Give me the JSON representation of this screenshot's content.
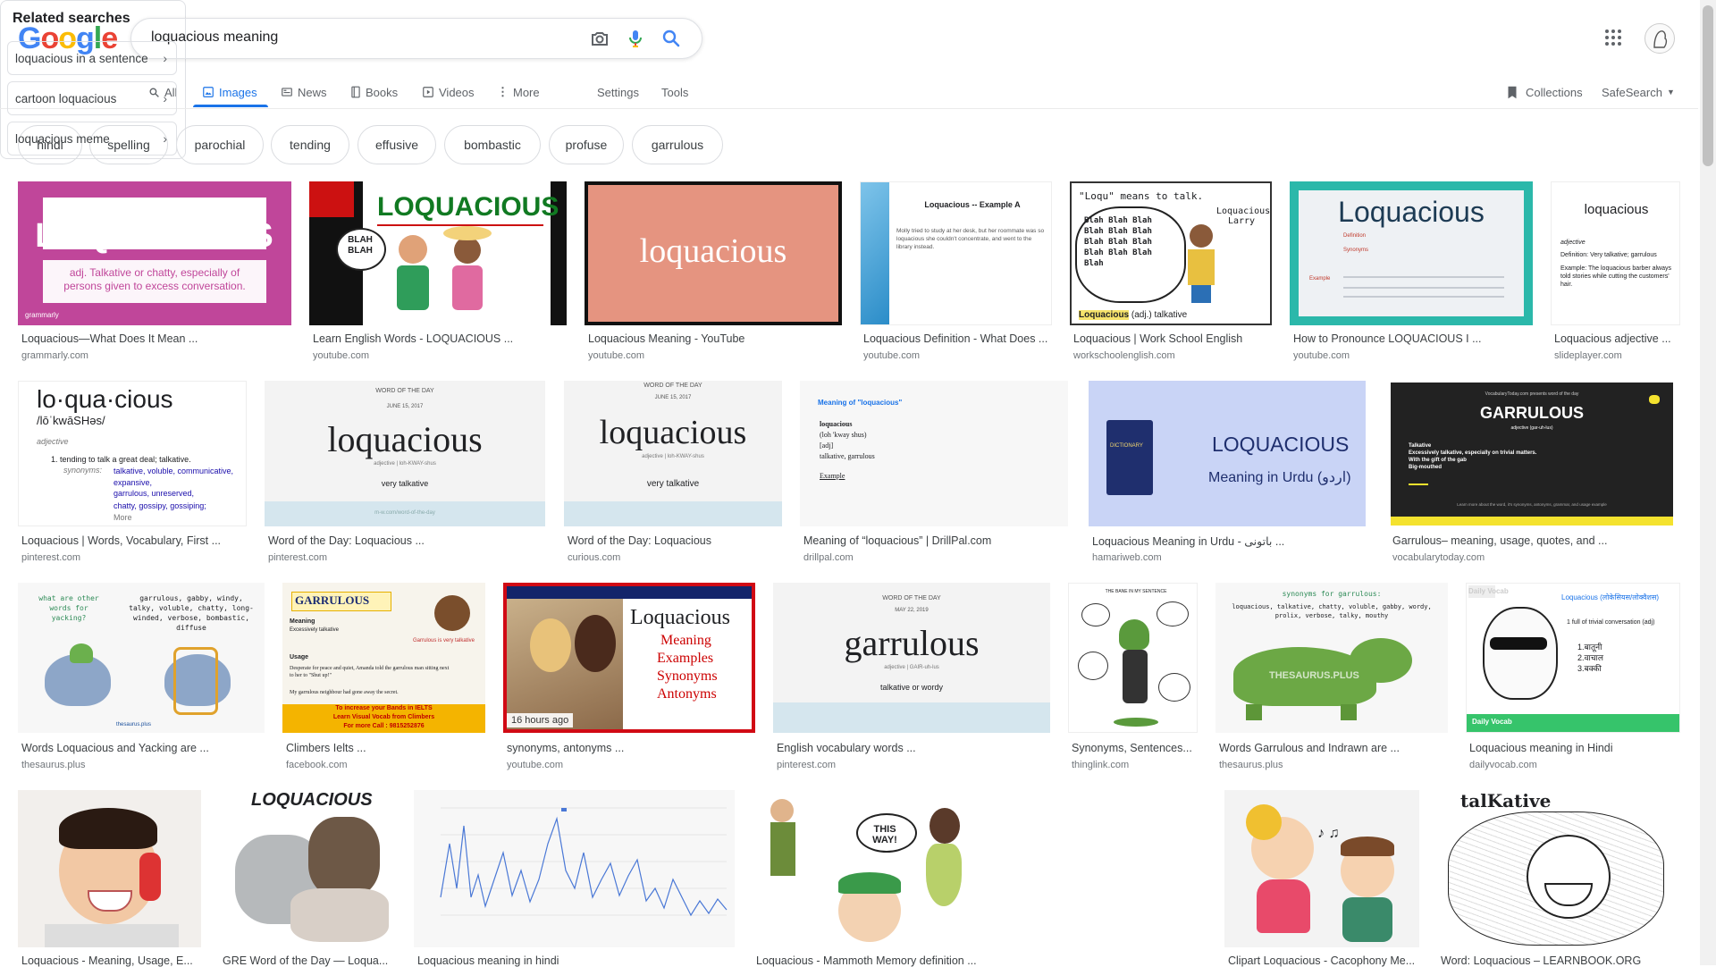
{
  "logo": "Google",
  "search": {
    "query": "loquacious meaning"
  },
  "nav": {
    "tabs": [
      "All",
      "Images",
      "News",
      "Books",
      "Videos",
      "More"
    ],
    "settings": "Settings",
    "tools": "Tools",
    "collections": "Collections",
    "safesearch": "SafeSearch"
  },
  "chips": [
    "hindi",
    "spelling",
    "parochial",
    "tending",
    "effusive",
    "bombastic",
    "profuse",
    "garrulous"
  ],
  "thumb_text": {
    "t1_word": "LOQUACIOUS",
    "t1_def": "adj. Talkative or chatty, especially of persons given to excess conversation.",
    "t1_brand": "grammarly",
    "t2_word": "LOQUACIOUS",
    "t2_blah": "BLAH BLAH",
    "t3_word": "loquacious",
    "t4_title": "Loquacious -- Example A",
    "t4_body": "Molly tried to study at her desk, but her roommate was so loquacious she couldn't concentrate, and went to the library instead.",
    "t5_quote": "\"Loqu\" means to talk.",
    "t5_name": "Loquacious Larry",
    "t5_def_word": "Loquacious",
    "t5_def": "(adj.) talkative",
    "t6_word": "Loquacious",
    "t6_label_def": "Definition",
    "t6_label_syn": "Synonyms",
    "t6_label_ex": "Example",
    "t7_word": "loquacious",
    "t7_pos": "adjective",
    "t7_def": "Definition: Very talkative; garrulous",
    "t7_ex": "Example: The loquacious barber always told stories while cutting the customers' hair.",
    "t8_word": "lo·qua·cious",
    "t8_pron": "/lōˈkwāSHəs/",
    "t8_pos": "adjective",
    "t8_def": "1. tending to talk a great deal; talkative.",
    "t8_syn_label": "synonyms:",
    "t8_syn1": "talkative, voluble, communicative, expansive,",
    "t8_syn2": "garrulous, unreserved,",
    "t8_syn3": "chatty, gossipy, gossiping;",
    "t8_more": "More",
    "wotd": "WORD OF THE DAY",
    "t9_date": "JUNE 15, 2017",
    "t9_word": "loquacious",
    "t9_pron": "adjective | loh-KWAY-shus",
    "t9_def": "very talkative",
    "t9_footer": "m-w.com/word-of-the-day",
    "t10_date": "JUNE 15, 2017",
    "t10_word": "loquacious",
    "t10_pron": "adjective | loh-KWAY-shus",
    "t10_def": "very talkative",
    "t11_title": "Meaning of \"loquacious\"",
    "t11_l1": "loquacious",
    "t11_l2": "(loh 'kway shus)",
    "t11_l3": "[adj]",
    "t11_l4": "talkative, garrulous",
    "t11_l5": "Example",
    "t12_word": "LOQUACIOUS",
    "t12_sub": "Meaning in Urdu (اردو)",
    "t12_book": "DICTIONARY",
    "t13_top": "VocabularyToday.com presents word of the day",
    "t13_word": "GARRULOUS",
    "t13_pos": "adjective (gar-uh-lus)",
    "t13_b1": "Talkative",
    "t13_b2": "Excessively talkative, especially on trivial matters.",
    "t13_b3": "With the gift of the gab",
    "t13_b4": "Big-mouthed",
    "t13_foot": "Learn more about the word, it's synonyms, antonyms, grammar, and usage example",
    "t14_left": "what are other words for yacking?",
    "t14_right": "garrulous, gabby, windy, talky, voluble, chatty, long-winded, verbose, bombastic, diffuse",
    "t14_brand": "thesaurus.plus",
    "t15_word": "GARRULOUS",
    "t15_m": "Meaning",
    "t15_m2": "Excessively talkative",
    "t15_u": "Usage",
    "t15_u1": "Desperate for peace and quiet, Amanda told the garrulous man sitting next to her to \"Shut up!\"",
    "t15_u2": "My garrulous neighbour had gone away the secret.",
    "t15_banner1": "To increase your Bands in IELTS",
    "t15_banner2": "Learn Visual Vocab from Climbers",
    "t15_banner3": "For more Call : 9815252876",
    "t15_bubble": "Garrulous is very talkative",
    "t16_word": "Loquacious",
    "t16_l1": "Meaning",
    "t16_l2": "Examples",
    "t16_l3": "Synonyms",
    "t16_l4": "Antonyms",
    "t16_badge": "16 hours ago",
    "t17_date": "MAY 22, 2019",
    "t17_word": "garrulous",
    "t17_pron": "adjective | GAIR-uh-lus",
    "t17_def": "talkative or wordy",
    "t18_title": "THE BANE IN MY SENTENCE",
    "t19_title": "synonyms for garrulous:",
    "t19_body": "loquacious, talkative, chatty, voluble, gabby, wordy, prolix, verbose, talky, mouthy",
    "t19_brand": "THESAURUS.PLUS",
    "t20_title": "Loquacious (लोकेसियस/लोक्वैशस)",
    "t20_brand": "Daily Vocab",
    "t20_def": "1 full of trivial conversation (adj)",
    "t20_h1": "1.बातूनी",
    "t20_h2": "2.वाचाल",
    "t20_h3": "3.बक्की",
    "t20_footer": "Daily Vocab",
    "t22_word": "LOQUACIOUS",
    "t25_bubble": "THIS WAY!",
    "t27_word": "talKative"
  },
  "results": [
    {
      "title": "Loquacious—What Does It Mean ...",
      "source": "grammarly.com"
    },
    {
      "title": "Learn English Words - LOQUACIOUS ...",
      "source": "youtube.com"
    },
    {
      "title": "Loquacious Meaning - YouTube",
      "source": "youtube.com"
    },
    {
      "title": "Loquacious Definition - What Does ...",
      "source": "youtube.com"
    },
    {
      "title": "Loquacious | Work School English",
      "source": "workschoolenglish.com"
    },
    {
      "title": "How to Pronounce LOQUACIOUS I ...",
      "source": "youtube.com"
    },
    {
      "title": "Loquacious adjective ...",
      "source": "slideplayer.com"
    },
    {
      "title": "Loquacious | Words, Vocabulary, First ...",
      "source": "pinterest.com"
    },
    {
      "title": "Word of the Day: Loquacious ...",
      "source": "pinterest.com"
    },
    {
      "title": "Word of the Day: Loquacious",
      "source": "curious.com"
    },
    {
      "title": "Meaning of “loquacious” | DrillPal.com",
      "source": "drillpal.com"
    },
    {
      "title": "Loquacious Meaning in Urdu - باتونی ...",
      "source": "hamariweb.com"
    },
    {
      "title": "Garrulous– meaning, usage, quotes, and ...",
      "source": "vocabularytoday.com"
    },
    {
      "title": "Words Loquacious and Yacking are ...",
      "source": "thesaurus.plus"
    },
    {
      "title": "Climbers Ielts ...",
      "source": "facebook.com"
    },
    {
      "title": "synonyms, antonyms ...",
      "source": "youtube.com"
    },
    {
      "title": "English vocabulary words ...",
      "source": "pinterest.com"
    },
    {
      "title": "Synonyms, Sentences...",
      "source": "thinglink.com"
    },
    {
      "title": "Words Garrulous and Indrawn are ...",
      "source": "thesaurus.plus"
    },
    {
      "title": "Loquacious meaning in Hindi",
      "source": "dailyvocab.com"
    },
    {
      "title": "Loquacious - Meaning, Usage, E...",
      "source": ""
    },
    {
      "title": "GRE Word of the Day — Loqua...",
      "source": ""
    },
    {
      "title": "Loquacious meaning in hindi",
      "source": ""
    },
    {
      "title": "Loquacious - Mammoth Memory definition ...",
      "source": ""
    },
    {
      "title": "Clipart Loquacious - Cacophony Me...",
      "source": ""
    },
    {
      "title": "Word: Loquacious – LEARNBOOK.ORG",
      "source": ""
    }
  ],
  "related": {
    "title": "Related searches",
    "items": [
      "loquacious in a sentence",
      "cartoon loquacious",
      "loquacious meme"
    ]
  },
  "colors": {
    "accent": "#1a73e8",
    "chip_border": "#dadce0"
  }
}
